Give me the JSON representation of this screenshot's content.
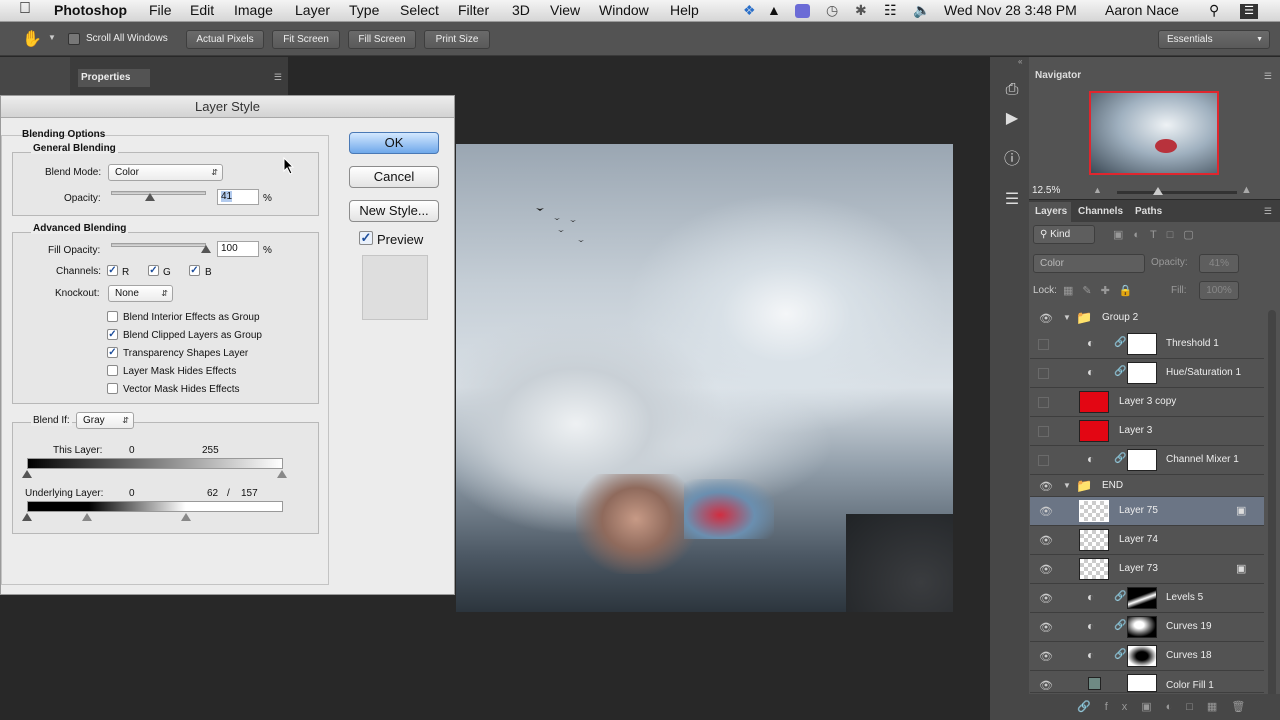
{
  "menubar": {
    "app": "Photoshop",
    "items": [
      "File",
      "Edit",
      "Image",
      "Layer",
      "Type",
      "Select",
      "Filter",
      "3D",
      "View",
      "Window",
      "Help"
    ],
    "clock": "Wed Nov 28  3:48 PM",
    "user": "Aaron Nace"
  },
  "options_bar": {
    "scroll_all": "Scroll All Windows",
    "actual_pixels": "Actual Pixels",
    "fit_screen": "Fit Screen",
    "fill_screen": "Fill Screen",
    "print_size": "Print Size",
    "workspace": "Essentials"
  },
  "properties_panel": {
    "title": "Properties"
  },
  "dialog": {
    "title": "Layer Style",
    "blending_options": "Blending Options",
    "general_blending": "General Blending",
    "blend_mode_label": "Blend Mode:",
    "blend_mode_value": "Color",
    "opacity_label": "Opacity:",
    "opacity_value": "41",
    "opacity_fraction": 0.41,
    "percent": "%",
    "advanced_blending": "Advanced Blending",
    "fill_opacity_label": "Fill Opacity:",
    "fill_opacity_value": "100",
    "channels_label": "Channels:",
    "channel_r": "R",
    "channel_g": "G",
    "channel_b": "B",
    "knockout_label": "Knockout:",
    "knockout_value": "None",
    "options": [
      {
        "label": "Blend Interior Effects as Group",
        "checked": false
      },
      {
        "label": "Blend Clipped Layers as Group",
        "checked": true
      },
      {
        "label": "Transparency Shapes Layer",
        "checked": true
      },
      {
        "label": "Layer Mask Hides Effects",
        "checked": false
      },
      {
        "label": "Vector Mask Hides Effects",
        "checked": false
      }
    ],
    "blend_if_label": "Blend If:",
    "blend_if_value": "Gray",
    "this_layer_label": "This Layer:",
    "this_layer_low": "0",
    "this_layer_high": "255",
    "underlying_label": "Underlying Layer:",
    "underlying_low": "0",
    "underlying_split_a": "62",
    "underlying_slash": "/",
    "underlying_split_b": "157",
    "ok": "OK",
    "cancel": "Cancel",
    "new_style": "New Style...",
    "preview": "Preview"
  },
  "navigator": {
    "title": "Navigator",
    "zoom": "12.5%"
  },
  "layers_panel": {
    "tabs": [
      "Layers",
      "Channels",
      "Paths"
    ],
    "kind": "Kind",
    "blend_mode": "Color",
    "opacity_label": "Opacity:",
    "opacity_value": "41%",
    "lock_label": "Lock:",
    "fill_label": "Fill:",
    "fill_value": "100%",
    "layers": [
      {
        "name": "Group 2",
        "type": "group",
        "visible": true
      },
      {
        "name": "Threshold 1",
        "type": "adjust",
        "visible": false
      },
      {
        "name": "Hue/Saturation 1",
        "type": "adjust",
        "visible": false
      },
      {
        "name": "Layer 3 copy",
        "type": "red",
        "visible": false
      },
      {
        "name": "Layer 3",
        "type": "red",
        "visible": false
      },
      {
        "name": "Channel Mixer 1",
        "type": "adjust",
        "visible": false
      },
      {
        "name": "END",
        "type": "group",
        "visible": true
      },
      {
        "name": "Layer 75",
        "type": "pixel",
        "visible": true,
        "selected": true
      },
      {
        "name": "Layer 74",
        "type": "pixel",
        "visible": true
      },
      {
        "name": "Layer 73",
        "type": "pixel",
        "visible": true
      },
      {
        "name": "Levels 5",
        "type": "adjust-dark",
        "visible": true
      },
      {
        "name": "Curves 19",
        "type": "adjust-dark",
        "visible": true
      },
      {
        "name": "Curves 18",
        "type": "adjust-dark",
        "visible": true
      },
      {
        "name": "Color Fill 1",
        "type": "fill",
        "visible": true
      }
    ]
  }
}
